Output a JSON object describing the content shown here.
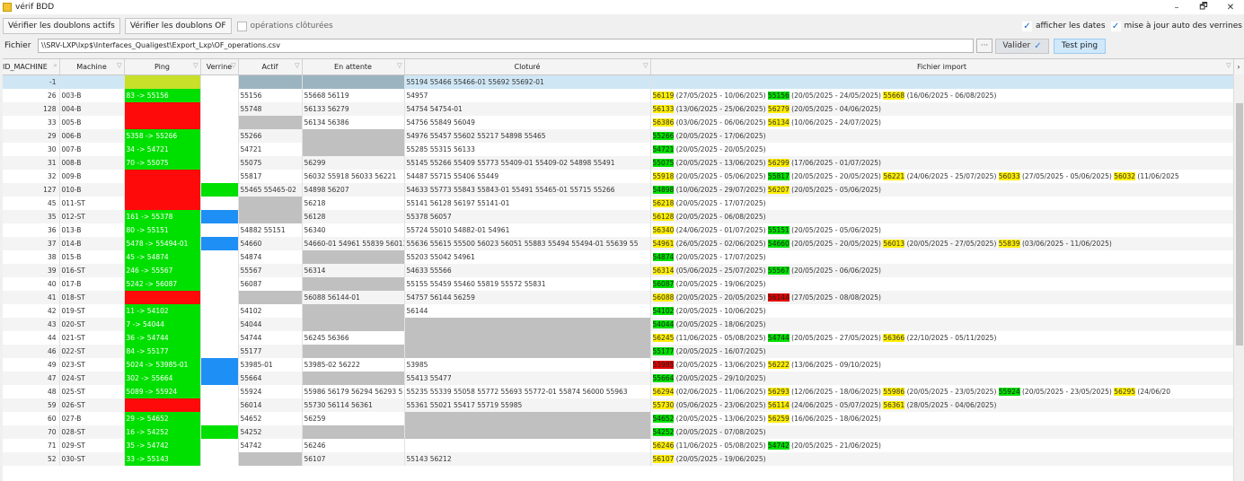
{
  "window": {
    "title": "vérif BDD",
    "minimize": "–",
    "maximize": "🗗",
    "close": "✕"
  },
  "toolbar": {
    "btn_active": "Vérifier les doublons actifs",
    "btn_of": "Vérifier les doublons OF",
    "chk_closed": "opérations clôturées",
    "chk_dates": "afficher les dates",
    "chk_auto": "mise à jour auto des verrines"
  },
  "file": {
    "label": "Fichier",
    "path": "\\\\SRV-LXP\\lxp$\\Interfaces_Qualigest\\Export_Lxp\\OF_operations.csv",
    "browse": "···",
    "validate": "Valider",
    "ping": "Test ping"
  },
  "columns": {
    "id": "ID_MACHINE",
    "machine": "Machine",
    "ping": "Ping",
    "verrine": "Verrine",
    "actif": "Actif",
    "attente": "En attente",
    "cloture": "Cloturé",
    "import": "Fichier import"
  },
  "rows": [
    {
      "id": "-1",
      "machine": "",
      "ping": "",
      "pc": "y",
      "vc": "wh",
      "actif": "",
      "ac": "sl",
      "attente": "",
      "ec": "sl",
      "cloture": "55194 55466 55466-01 55692 55692-01",
      "imp": []
    },
    {
      "id": "26",
      "machine": "003-B",
      "ping": "83 -> 55156",
      "pc": "g",
      "vc": "wh",
      "actif": "55156",
      "ac": "",
      "attente": "55668 56119",
      "ec": "",
      "cloture": "54957",
      "imp": [
        [
          "56119",
          "y"
        ],
        [
          " (27/05/2025 - 10/06/2025) ",
          ""
        ],
        [
          "55156",
          "g"
        ],
        [
          " (20/05/2025 - 24/05/2025) ",
          ""
        ],
        [
          "55668",
          "y"
        ],
        [
          " (16/06/2025 - 06/08/2025)",
          ""
        ]
      ]
    },
    {
      "id": "128",
      "machine": "004-B",
      "ping": "",
      "pc": "r",
      "vc": "wh",
      "actif": "55748",
      "ac": "",
      "attente": "56133 56279",
      "ec": "",
      "cloture": "54754 54754-01",
      "imp": [
        [
          "56133",
          "y"
        ],
        [
          " (13/06/2025 - 25/06/2025) ",
          ""
        ],
        [
          "56279",
          "y"
        ],
        [
          " (20/05/2025 - 04/06/2025)",
          ""
        ]
      ]
    },
    {
      "id": "33",
      "machine": "005-B",
      "ping": "",
      "pc": "r",
      "vc": "wh",
      "actif": "",
      "ac": "gr",
      "attente": "56134 56386",
      "ec": "",
      "cloture": "54756 55849 56049",
      "imp": [
        [
          "56386",
          "y"
        ],
        [
          " (03/06/2025 - 06/06/2025) ",
          ""
        ],
        [
          "56134",
          "y"
        ],
        [
          " (10/06/2025 - 24/07/2025)",
          ""
        ]
      ]
    },
    {
      "id": "29",
      "machine": "006-B",
      "ping": "5358 -> 55266",
      "pc": "g",
      "vc": "wh",
      "actif": "55266",
      "ac": "",
      "attente": "",
      "ec": "gr",
      "cloture": "54976 55457 55602 55217 54898 55465",
      "imp": [
        [
          "55266",
          "g"
        ],
        [
          " (20/05/2025 - 17/06/2025)",
          ""
        ]
      ]
    },
    {
      "id": "30",
      "machine": "007-B",
      "ping": "34 -> 54721",
      "pc": "g",
      "vc": "wh",
      "actif": "54721",
      "ac": "",
      "attente": "",
      "ec": "gr",
      "cloture": "55285 55315 56133",
      "imp": [
        [
          "54721",
          "g"
        ],
        [
          " (20/05/2025 - 20/05/2025)",
          ""
        ]
      ]
    },
    {
      "id": "31",
      "machine": "008-B",
      "ping": "70 -> 55075",
      "pc": "g",
      "vc": "wh",
      "actif": "55075",
      "ac": "",
      "attente": "56299",
      "ec": "",
      "cloture": "55145 55266 55409 55773 55409-01 55409-02 54898 55491",
      "imp": [
        [
          "55075",
          "g"
        ],
        [
          " (20/05/2025 - 13/06/2025) ",
          ""
        ],
        [
          "56299",
          "y"
        ],
        [
          " (17/06/2025 - 01/07/2025)",
          ""
        ]
      ]
    },
    {
      "id": "32",
      "machine": "009-B",
      "ping": "",
      "pc": "r",
      "vc": "wh",
      "actif": "55817",
      "ac": "",
      "attente": "56032 55918 56033 56221",
      "ec": "",
      "cloture": "54487 55715 55406 55449",
      "imp": [
        [
          "55918",
          "y"
        ],
        [
          " (20/05/2025 - 05/06/2025) ",
          ""
        ],
        [
          "55817",
          "g"
        ],
        [
          " (20/05/2025 - 20/05/2025) ",
          ""
        ],
        [
          "56221",
          "y"
        ],
        [
          " (24/06/2025 - 25/07/2025) ",
          ""
        ],
        [
          "56033",
          "y"
        ],
        [
          " (27/05/2025 - 05/06/2025) ",
          ""
        ],
        [
          "56032",
          "y"
        ],
        [
          " (11/06/2025",
          ""
        ]
      ]
    },
    {
      "id": "127",
      "machine": "010-B",
      "ping": "",
      "pc": "r",
      "vc": "g",
      "actif": "55465 55465-02",
      "ac": "",
      "attente": "54898 56207",
      "ec": "",
      "cloture": "54633 55773 55843 55843-01 55491 55465-01 55715 55266",
      "imp": [
        [
          "54898",
          "g"
        ],
        [
          " (10/06/2025 - 29/07/2025) ",
          ""
        ],
        [
          "56207",
          "y"
        ],
        [
          " (20/05/2025 - 05/06/2025)",
          ""
        ]
      ]
    },
    {
      "id": "45",
      "machine": "011-ST",
      "ping": "",
      "pc": "r",
      "vc": "wh",
      "actif": "",
      "ac": "gr",
      "attente": "56218",
      "ec": "",
      "cloture": "55141 56128 56197 55141-01",
      "imp": [
        [
          "56218",
          "y"
        ],
        [
          " (20/05/2025 - 17/07/2025)",
          ""
        ]
      ]
    },
    {
      "id": "35",
      "machine": "012-ST",
      "ping": "161 -> 55378",
      "pc": "g",
      "vc": "b",
      "actif": "",
      "ac": "gr",
      "attente": "56128",
      "ec": "",
      "cloture": "55378 56057",
      "imp": [
        [
          "56128",
          "y"
        ],
        [
          " (20/05/2025 - 06/08/2025)",
          ""
        ]
      ]
    },
    {
      "id": "36",
      "machine": "013-B",
      "ping": "80 -> 55151",
      "pc": "g",
      "vc": "wh",
      "actif": "54882 55151",
      "ac": "",
      "attente": "56340",
      "ec": "",
      "cloture": "55724 55010 54882-01 54961",
      "imp": [
        [
          "56340",
          "y"
        ],
        [
          " (24/06/2025 - 01/07/2025) ",
          ""
        ],
        [
          "55151",
          "g"
        ],
        [
          " (20/05/2025 - 05/06/2025)",
          ""
        ]
      ]
    },
    {
      "id": "37",
      "machine": "014-B",
      "ping": "5478 -> 55494-01",
      "pc": "g",
      "vc": "b",
      "actif": "54660",
      "ac": "",
      "attente": "54660-01 54961 55839 56013",
      "ec": "",
      "cloture": "55636 55615 55500 56023 56051 55883 55494 55494-01 55639 55",
      "imp": [
        [
          "54961",
          "y"
        ],
        [
          " (26/05/2025 - 02/06/2025) ",
          ""
        ],
        [
          "54660",
          "g"
        ],
        [
          " (20/05/2025 - 20/05/2025) ",
          ""
        ],
        [
          "56013",
          "y"
        ],
        [
          " (20/05/2025 - 27/05/2025) ",
          ""
        ],
        [
          "55839",
          "y"
        ],
        [
          " (03/06/2025 - 11/06/2025)",
          ""
        ]
      ]
    },
    {
      "id": "38",
      "machine": "015-B",
      "ping": "45 -> 54874",
      "pc": "g",
      "vc": "wh",
      "actif": "54874",
      "ac": "",
      "attente": "",
      "ec": "gr",
      "cloture": "55203 55042 54961",
      "imp": [
        [
          "54874",
          "g"
        ],
        [
          " (20/05/2025 - 17/07/2025)",
          ""
        ]
      ]
    },
    {
      "id": "39",
      "machine": "016-ST",
      "ping": "246 -> 55567",
      "pc": "g",
      "vc": "wh",
      "actif": "55567",
      "ac": "",
      "attente": "56314",
      "ec": "",
      "cloture": "54633 55566",
      "imp": [
        [
          "56314",
          "y"
        ],
        [
          " (05/06/2025 - 25/07/2025) ",
          ""
        ],
        [
          "55567",
          "g"
        ],
        [
          " (20/05/2025 - 06/06/2025)",
          ""
        ]
      ]
    },
    {
      "id": "40",
      "machine": "017-B",
      "ping": "5242 -> 56087",
      "pc": "g",
      "vc": "wh",
      "actif": "56087",
      "ac": "",
      "attente": "",
      "ec": "gr",
      "cloture": "55155 55459 55460 55819 55572 55831",
      "imp": [
        [
          "56087",
          "g"
        ],
        [
          " (20/05/2025 - 19/06/2025)",
          ""
        ]
      ]
    },
    {
      "id": "41",
      "machine": "018-ST",
      "ping": "",
      "pc": "r",
      "vc": "wh",
      "actif": "",
      "ac": "gr",
      "attente": "56088 56144-01",
      "ec": "",
      "cloture": "54757 56144 56259",
      "imp": [
        [
          "56088",
          "y"
        ],
        [
          " (20/05/2025 - 20/05/2025) ",
          ""
        ],
        [
          "56144",
          "r"
        ],
        [
          " (27/05/2025 - 08/08/2025)",
          ""
        ]
      ]
    },
    {
      "id": "42",
      "machine": "019-ST",
      "ping": "11 -> 54102",
      "pc": "g",
      "vc": "wh",
      "actif": "54102",
      "ac": "",
      "attente": "",
      "ec": "gr",
      "cloture": "56144",
      "imp": [
        [
          "54102",
          "g"
        ],
        [
          " (20/05/2025 - 10/06/2025)",
          ""
        ]
      ]
    },
    {
      "id": "43",
      "machine": "020-ST",
      "ping": "7 -> 54044",
      "pc": "g",
      "vc": "wh",
      "actif": "54044",
      "ac": "",
      "attente": "",
      "ec": "gr",
      "cloture": "",
      "cc": "gr",
      "imp": [
        [
          "54044",
          "g"
        ],
        [
          " (20/05/2025 - 18/06/2025)",
          ""
        ]
      ]
    },
    {
      "id": "44",
      "machine": "021-ST",
      "ping": "36 -> 54744",
      "pc": "g",
      "vc": "wh",
      "actif": "54744",
      "ac": "",
      "attente": "56245 56366",
      "ec": "",
      "cloture": "",
      "cc": "gr",
      "imp": [
        [
          "56245",
          "y"
        ],
        [
          " (11/06/2025 - 05/08/2025) ",
          ""
        ],
        [
          "54744",
          "g"
        ],
        [
          " (20/05/2025 - 27/05/2025) ",
          ""
        ],
        [
          "56366",
          "y"
        ],
        [
          " (22/10/2025 - 05/11/2025)",
          ""
        ]
      ]
    },
    {
      "id": "46",
      "machine": "022-ST",
      "ping": "84 -> 55177",
      "pc": "g",
      "vc": "wh",
      "actif": "55177",
      "ac": "",
      "attente": "",
      "ec": "gr",
      "cloture": "",
      "cc": "gr",
      "imp": [
        [
          "55177",
          "g"
        ],
        [
          " (20/05/2025 - 16/07/2025)",
          ""
        ]
      ]
    },
    {
      "id": "49",
      "machine": "023-ST",
      "ping": "5024 -> 53985-01",
      "pc": "g",
      "vc": "b",
      "actif": "53985-01",
      "ac": "",
      "attente": "53985-02 56222",
      "ec": "",
      "cloture": "53985",
      "imp": [
        [
          "53985",
          "r"
        ],
        [
          " (20/05/2025 - 13/06/2025) ",
          ""
        ],
        [
          "56222",
          "y"
        ],
        [
          " (13/06/2025 - 09/10/2025)",
          ""
        ]
      ]
    },
    {
      "id": "47",
      "machine": "024-ST",
      "ping": "302 -> 55664",
      "pc": "g",
      "vc": "b",
      "actif": "55664",
      "ac": "",
      "attente": "",
      "ec": "gr",
      "cloture": "55413 55477",
      "imp": [
        [
          "55664",
          "g"
        ],
        [
          " (20/05/2025 - 29/10/2025)",
          ""
        ]
      ]
    },
    {
      "id": "48",
      "machine": "025-ST",
      "ping": "5089 -> 55924",
      "pc": "g",
      "vc": "wh",
      "actif": "55924",
      "ac": "",
      "attente": "55986 56179 56294 56293 5",
      "ec": "",
      "cloture": "55235 55339 55058 55772 55693 55772-01 55874 56000 55963",
      "imp": [
        [
          "56294",
          "y"
        ],
        [
          " (02/06/2025 - 11/06/2025) ",
          ""
        ],
        [
          "56293",
          "y"
        ],
        [
          " (12/06/2025 - 18/06/2025) ",
          ""
        ],
        [
          "55986",
          "y"
        ],
        [
          " (20/05/2025 - 23/05/2025) ",
          ""
        ],
        [
          "55924",
          "g"
        ],
        [
          " (20/05/2025 - 23/05/2025) ",
          ""
        ],
        [
          "56295",
          "y"
        ],
        [
          " (24/06/20",
          ""
        ]
      ]
    },
    {
      "id": "59",
      "machine": "026-ST",
      "ping": "",
      "pc": "r",
      "vc": "wh",
      "actif": "56014",
      "ac": "",
      "attente": "55730 56114 56361",
      "ec": "",
      "cloture": "55361 55021 55417 55719 55985",
      "imp": [
        [
          "55730",
          "y"
        ],
        [
          " (05/06/2025 - 23/06/2025) ",
          ""
        ],
        [
          "56114",
          "y"
        ],
        [
          " (24/06/2025 - 05/07/2025) ",
          ""
        ],
        [
          "56361",
          "y"
        ],
        [
          " (28/05/2025 - 04/06/2025)",
          ""
        ]
      ]
    },
    {
      "id": "60",
      "machine": "027-B",
      "ping": "29 -> 54652",
      "pc": "g",
      "vc": "wh",
      "actif": "54652",
      "ac": "",
      "attente": "56259",
      "ec": "",
      "cloture": "",
      "cc": "gr",
      "imp": [
        [
          "54652",
          "g"
        ],
        [
          " (20/05/2025 - 13/06/2025) ",
          ""
        ],
        [
          "56259",
          "y"
        ],
        [
          " (16/06/2025 - 18/06/2025)",
          ""
        ]
      ]
    },
    {
      "id": "70",
      "machine": "028-ST",
      "ping": "16 -> 54252",
      "pc": "g",
      "vc": "g",
      "actif": "54252",
      "ac": "",
      "attente": "",
      "ec": "gr",
      "cloture": "",
      "cc": "gr",
      "imp": [
        [
          "54252",
          "g"
        ],
        [
          " (20/05/2025 - 07/08/2025)",
          ""
        ]
      ]
    },
    {
      "id": "71",
      "machine": "029-ST",
      "ping": "35 -> 54742",
      "pc": "g",
      "vc": "wh",
      "actif": "54742",
      "ac": "",
      "attente": "56246",
      "ec": "",
      "cloture": "",
      "cc": "wh",
      "imp": [
        [
          "56246",
          "y"
        ],
        [
          " (11/06/2025 - 05/08/2025) ",
          ""
        ],
        [
          "54742",
          "g"
        ],
        [
          " (20/05/2025 - 21/06/2025)",
          ""
        ]
      ]
    },
    {
      "id": "52",
      "machine": "030-ST",
      "ping": "33 -> 55143",
      "pc": "g",
      "vc": "wh",
      "actif": "",
      "ac": "gr",
      "attente": "56107",
      "ec": "",
      "cloture": "55143 56212",
      "imp": [
        [
          "56107",
          "y"
        ],
        [
          " (20/05/2025 - 19/06/2025)",
          ""
        ]
      ]
    }
  ]
}
